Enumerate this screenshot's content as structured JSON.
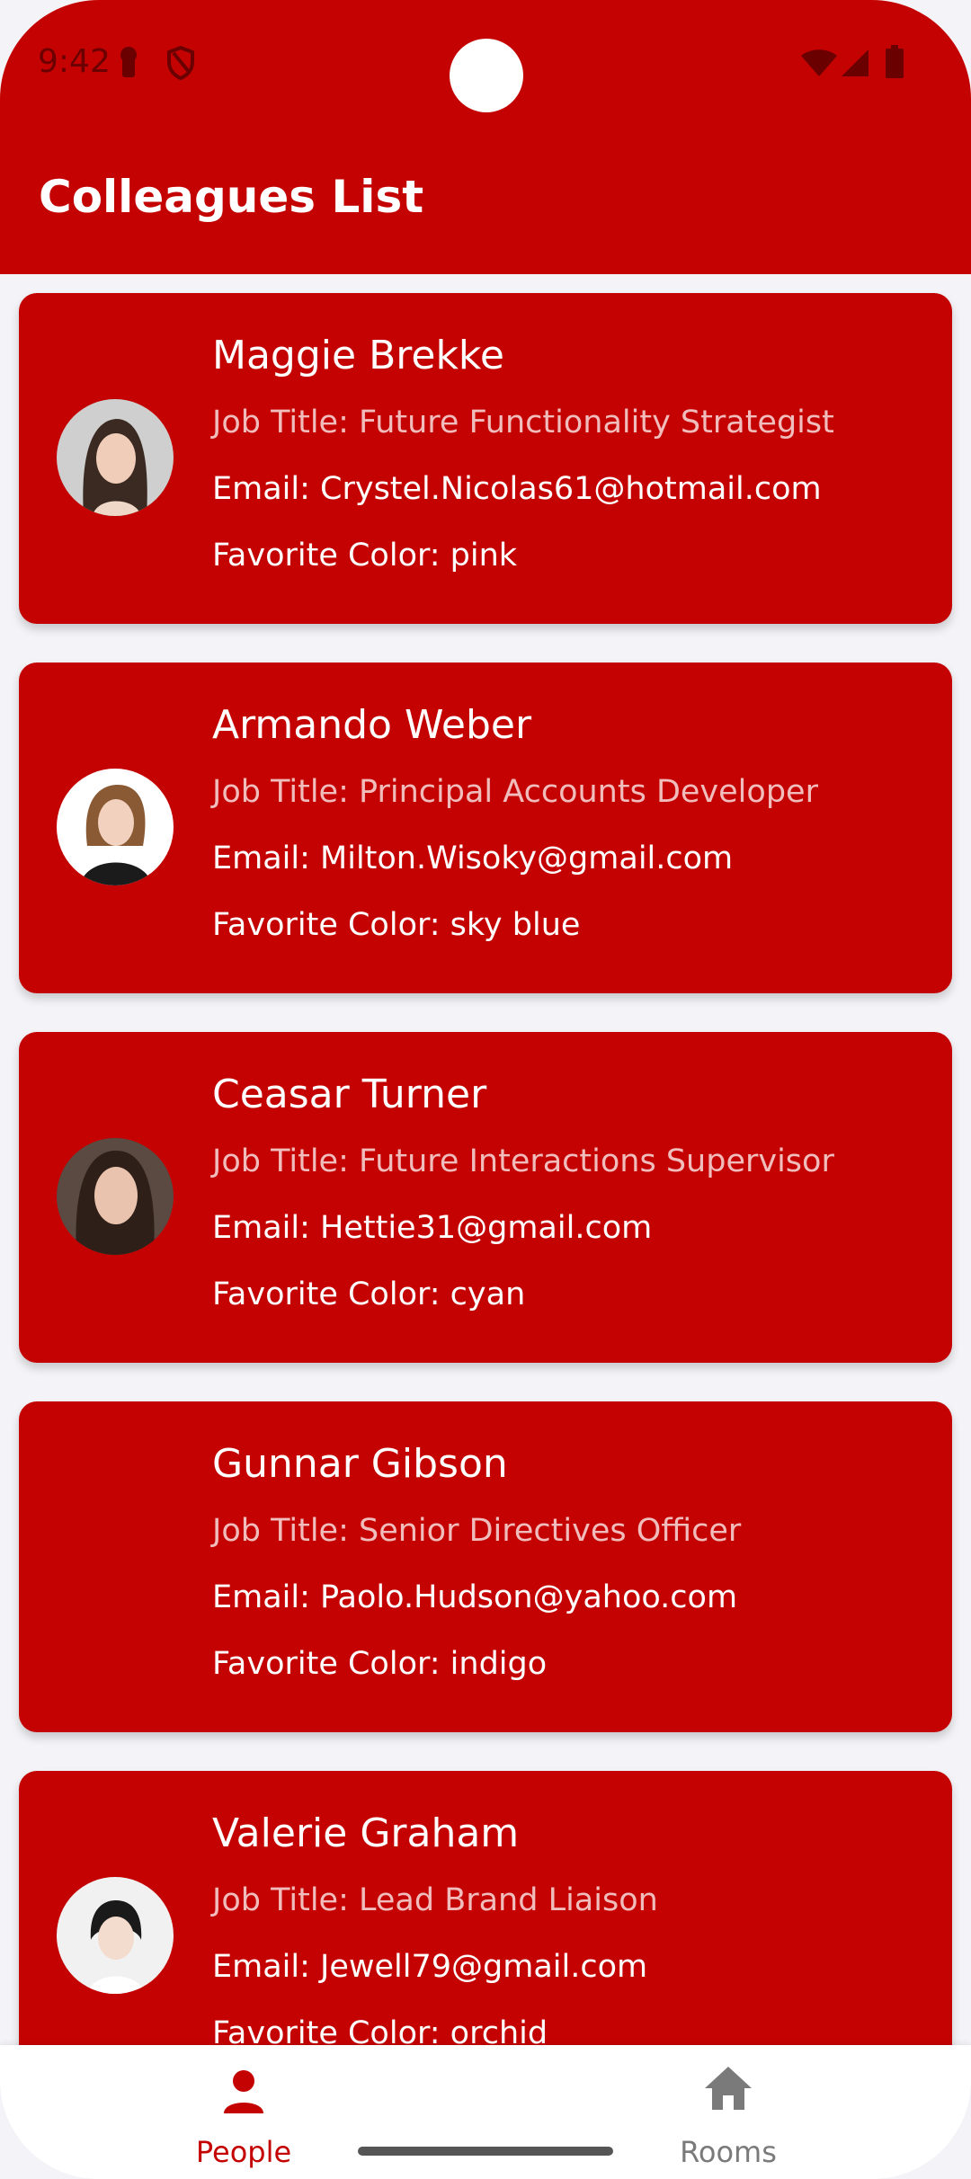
{
  "status_bar": {
    "time": "9:42",
    "icons": [
      "keyhole-icon",
      "shield-icon",
      "wifi-icon",
      "signal-icon",
      "battery-icon"
    ]
  },
  "app_bar": {
    "title": "Colleagues List"
  },
  "colors": {
    "primary": "#c40202",
    "background": "#f4f4f8",
    "nav_inactive": "#7a7a7a"
  },
  "colleagues": [
    {
      "name": "Maggie Brekke",
      "job": "Job Title: Future Functionality Strategist",
      "email": "Email: Crystel.Nicolas61@hotmail.com",
      "color": "Favorite Color: pink",
      "has_avatar": true
    },
    {
      "name": "Armando Weber",
      "job": "Job Title: Principal Accounts Developer",
      "email": "Email: Milton.Wisoky@gmail.com",
      "color": "Favorite Color: sky blue",
      "has_avatar": true
    },
    {
      "name": "Ceasar Turner",
      "job": "Job Title: Future Interactions Supervisor",
      "email": "Email: Hettie31@gmail.com",
      "color": "Favorite Color: cyan",
      "has_avatar": true
    },
    {
      "name": "Gunnar Gibson",
      "job": "Job Title: Senior Directives Officer",
      "email": "Email: Paolo.Hudson@yahoo.com",
      "color": "Favorite Color: indigo",
      "has_avatar": false
    },
    {
      "name": "Valerie Graham",
      "job": "Job Title: Lead Brand Liaison",
      "email": "Email: Jewell79@gmail.com",
      "color": "Favorite Color: orchid",
      "has_avatar": true
    }
  ],
  "bottom_nav": {
    "items": [
      {
        "label": "People",
        "icon": "person-icon",
        "selected": true
      },
      {
        "label": "Rooms",
        "icon": "home-icon",
        "selected": false
      }
    ]
  }
}
